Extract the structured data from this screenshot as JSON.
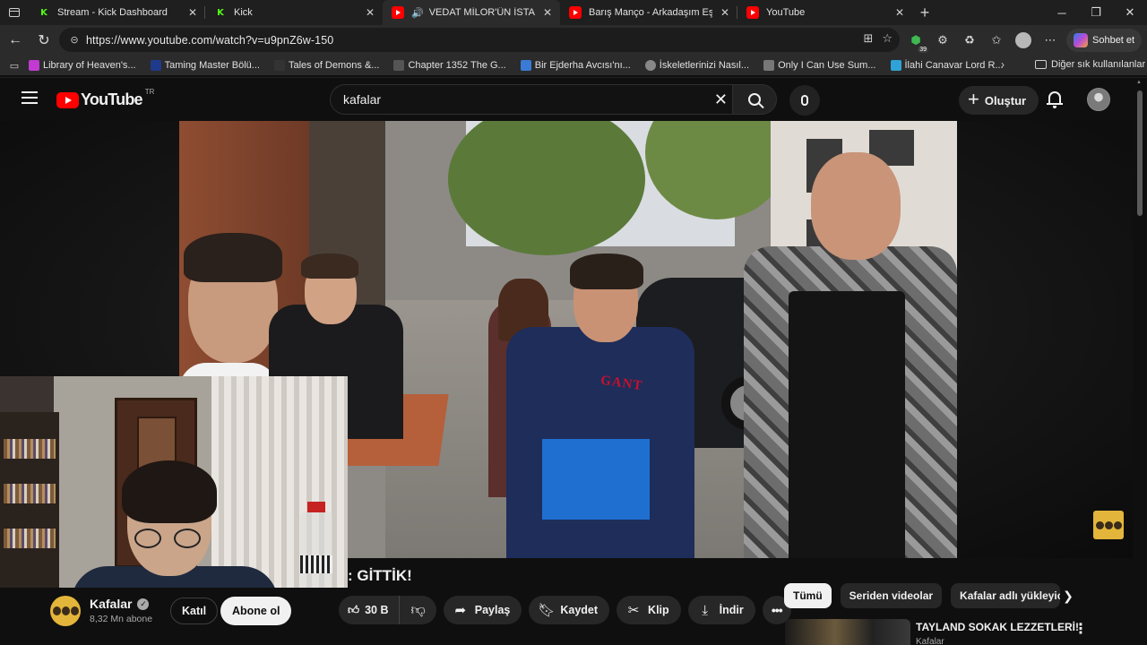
{
  "browser": {
    "tabs": [
      {
        "label": "Stream - Kick Dashboard",
        "favicon": "kick-icon",
        "active": false
      },
      {
        "label": "Kick",
        "favicon": "kick-icon",
        "active": false
      },
      {
        "label": "VEDAT MİLOR'ÜN İSTANBUL",
        "favicon": "youtube-icon",
        "active": true,
        "audio": true
      },
      {
        "label": "Barış Manço - Arkadaşım Eşek - Y",
        "favicon": "youtube-icon",
        "active": false
      },
      {
        "label": "YouTube",
        "favicon": "youtube-icon",
        "active": false
      }
    ],
    "url": "https://www.youtube.com/watch?v=u9pnZ6w-150",
    "extension_badge": "39",
    "copilot_label": "Sohbet et",
    "bookmarks": [
      {
        "label": "Library of Heaven's...",
        "color": "#c13bd2"
      },
      {
        "label": "Taming Master Bölü...",
        "color": "#1f3a8a"
      },
      {
        "label": "Tales of Demons &...",
        "color": "#333333"
      },
      {
        "label": "Chapter 1352 The G...",
        "color": "#555555"
      },
      {
        "label": "Bir Ejderha Avcısı'nı...",
        "color": "#3a7bd5"
      },
      {
        "label": "İskeletlerinizi Nasıl...",
        "color": "#888888"
      },
      {
        "label": "Only I Can Use Sum...",
        "color": "#777777"
      },
      {
        "label": "İlahi Canavar Lord R...",
        "color": "#2fa3d8"
      }
    ],
    "bookmark_folder": "Diğer sık kullanılanlar"
  },
  "youtube": {
    "logo_text": "YouTube",
    "country_code": "TR",
    "search_value": "kafalar",
    "create_label": "Oluştur",
    "title_fragment": ": GİTTİK!",
    "channel": {
      "name": "Kafalar",
      "subscribers": "8,32 Mn abone",
      "join_label": "Katıl",
      "subscribe_label": "Abone ol"
    },
    "actions": {
      "like_count": "30 B",
      "share": "Paylaş",
      "save": "Kaydet",
      "clip": "Klip",
      "download": "İndir"
    },
    "chips": [
      "Tümü",
      "Seriden videolar",
      "Kafalar adlı yükleyicid"
    ],
    "recommended": {
      "title": "TAYLAND SOKAK LEZZETLERİ!",
      "channel": "Kafalar"
    }
  },
  "colors": {
    "accent": "#ff0000",
    "kick_green": "#53fc18",
    "background": "#0f0f0f"
  }
}
